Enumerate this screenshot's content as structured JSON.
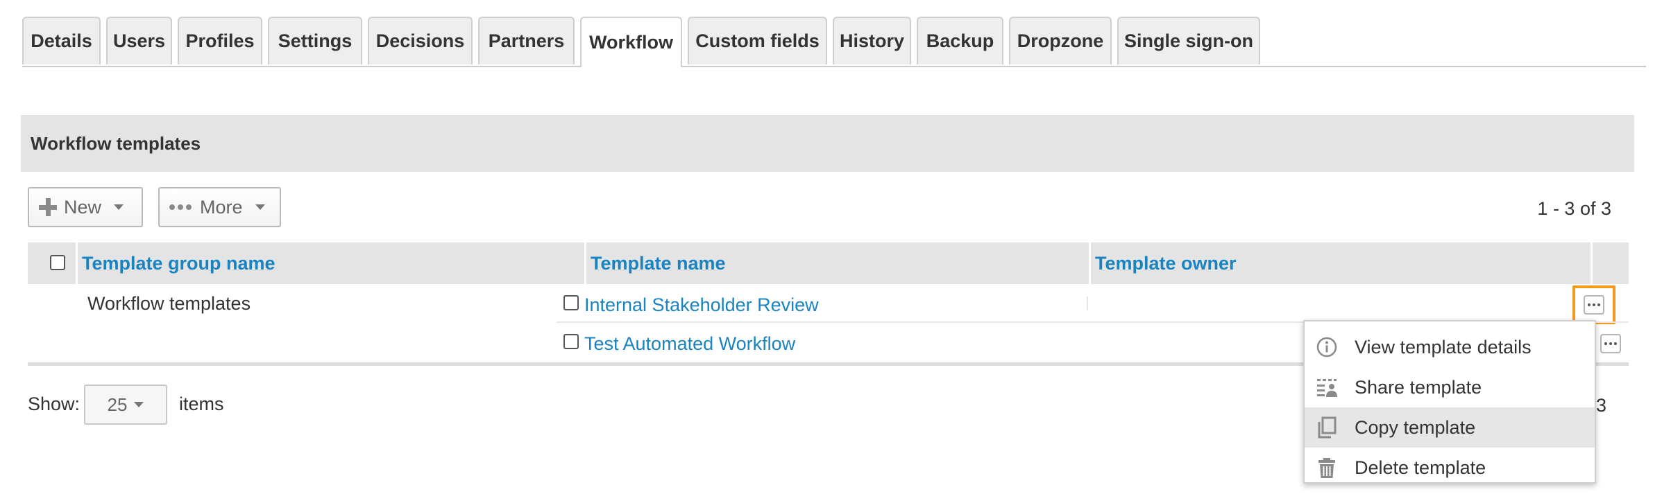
{
  "tabs": [
    {
      "label": "Details"
    },
    {
      "label": "Users"
    },
    {
      "label": "Profiles"
    },
    {
      "label": "Settings"
    },
    {
      "label": "Decisions"
    },
    {
      "label": "Partners"
    },
    {
      "label": "Workflow",
      "active": true
    },
    {
      "label": "Custom fields"
    },
    {
      "label": "History"
    },
    {
      "label": "Backup"
    },
    {
      "label": "Dropzone"
    },
    {
      "label": "Single sign-on"
    }
  ],
  "panel": {
    "title": "Workflow templates"
  },
  "toolbar": {
    "new_label": "New",
    "more_label": "More",
    "pager": "1 - 3 of 3"
  },
  "table": {
    "headers": [
      "Template group name",
      "Template name",
      "Template owner"
    ],
    "group_name": "Workflow templates",
    "rows": [
      {
        "template_name": "Internal Stakeholder Review",
        "owner": ""
      },
      {
        "template_name": "Test Automated Workflow",
        "owner": ""
      }
    ]
  },
  "footer": {
    "show_label": "Show:",
    "page_size": "25",
    "items_label": "items",
    "pager_partial": "3"
  },
  "context_menu": {
    "items": [
      {
        "label": "View template details",
        "icon": "info-icon"
      },
      {
        "label": "Share template",
        "icon": "share-icon"
      },
      {
        "label": "Copy template",
        "icon": "copy-icon",
        "highlighted": true
      },
      {
        "label": "Delete template",
        "icon": "trash-icon"
      }
    ]
  },
  "colors": {
    "link": "#1a84c1",
    "header_bg": "#e4e4e4",
    "focus_ring": "#f29a1e",
    "menu_hover": "#e6e6e6"
  }
}
